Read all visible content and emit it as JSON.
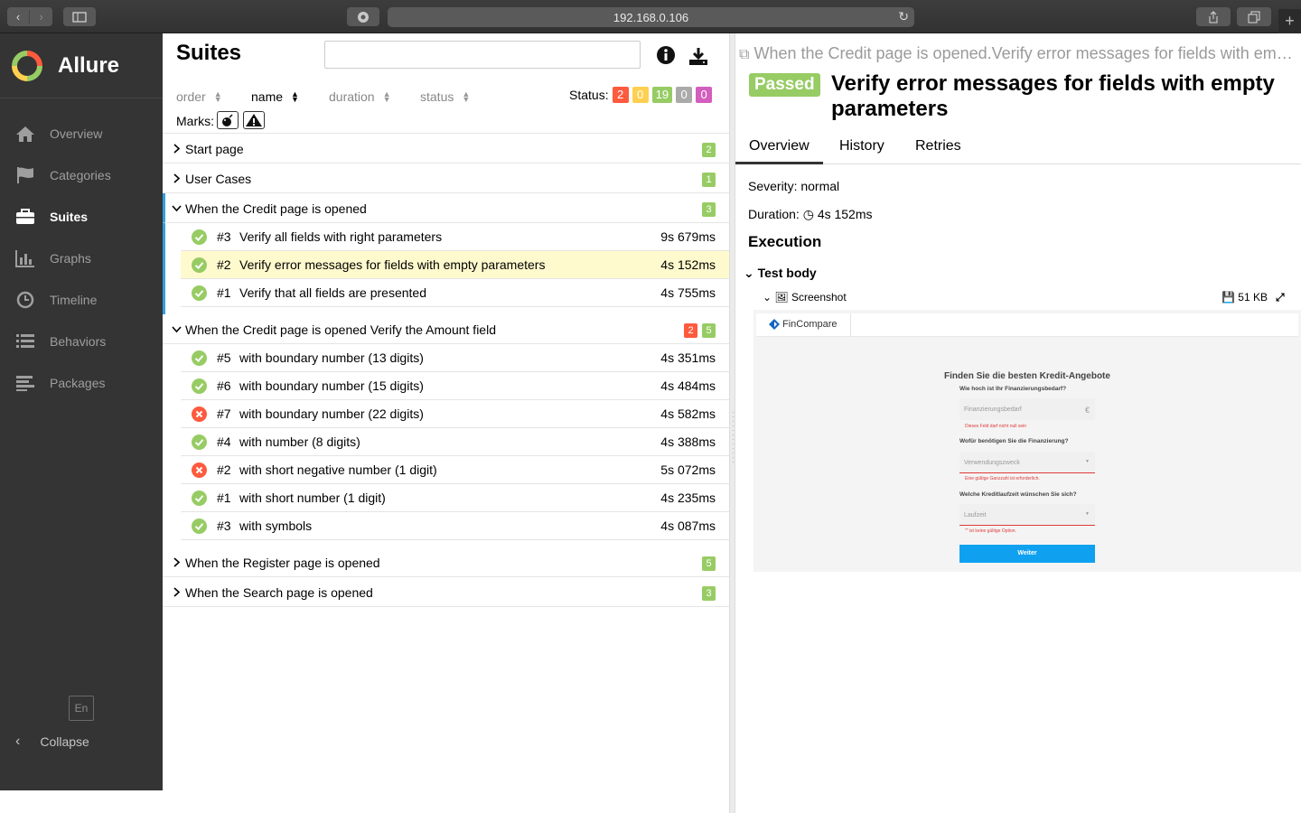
{
  "browser": {
    "url": "192.168.0.106"
  },
  "app": {
    "name": "Allure",
    "lang": "En",
    "collapse_label": "Collapse"
  },
  "nav": [
    {
      "label": "Overview",
      "icon": "home-icon"
    },
    {
      "label": "Categories",
      "icon": "flag-icon"
    },
    {
      "label": "Suites",
      "icon": "briefcase-icon",
      "active": true
    },
    {
      "label": "Graphs",
      "icon": "bar-chart-icon"
    },
    {
      "label": "Timeline",
      "icon": "clock-icon"
    },
    {
      "label": "Behaviors",
      "icon": "list-icon"
    },
    {
      "label": "Packages",
      "icon": "align-left-icon"
    }
  ],
  "suites": {
    "title": "Suites",
    "sort": [
      "order",
      "name",
      "duration",
      "status"
    ],
    "status_label": "Status:",
    "status_counts": [
      {
        "value": "2",
        "color": "#fd5a3e"
      },
      {
        "value": "0",
        "color": "#ffd050"
      },
      {
        "value": "19",
        "color": "#97cc64"
      },
      {
        "value": "0",
        "color": "#aaaaaa"
      },
      {
        "value": "0",
        "color": "#d35ebe"
      }
    ],
    "marks_label": "Marks:",
    "groups": [
      {
        "name": "Start page",
        "counts": [
          {
            "v": "2",
            "c": "#97cc64"
          }
        ],
        "expanded": false
      },
      {
        "name": "User Cases",
        "counts": [
          {
            "v": "1",
            "c": "#97cc64"
          }
        ],
        "expanded": false
      },
      {
        "name": "When the Credit page is opened",
        "counts": [
          {
            "v": "3",
            "c": "#97cc64"
          }
        ],
        "expanded": true,
        "cases": [
          {
            "num": "#3",
            "title": "Verify all fields with right parameters",
            "dur": "9s 679ms",
            "status": "passed"
          },
          {
            "num": "#2",
            "title": "Verify error messages for fields with empty parameters",
            "dur": "4s 152ms",
            "status": "passed",
            "selected": true
          },
          {
            "num": "#1",
            "title": "Verify that all fields are presented",
            "dur": "4s 755ms",
            "status": "passed"
          }
        ]
      },
      {
        "name": "When the Credit page is opened Verify the Amount field",
        "counts": [
          {
            "v": "2",
            "c": "#fd5a3e"
          },
          {
            "v": "5",
            "c": "#97cc64"
          }
        ],
        "expanded": true,
        "cases": [
          {
            "num": "#5",
            "title": "with boundary number (13 digits)",
            "dur": "4s 351ms",
            "status": "passed"
          },
          {
            "num": "#6",
            "title": "with boundary number (15 digits)",
            "dur": "4s 484ms",
            "status": "passed"
          },
          {
            "num": "#7",
            "title": "with boundary number (22 digits)",
            "dur": "4s 582ms",
            "status": "failed"
          },
          {
            "num": "#4",
            "title": "with number (8 digits)",
            "dur": "4s 388ms",
            "status": "passed"
          },
          {
            "num": "#2",
            "title": "with short negative number (1 digit)",
            "dur": "5s 072ms",
            "status": "failed"
          },
          {
            "num": "#1",
            "title": "with short number (1 digit)",
            "dur": "4s 235ms",
            "status": "passed"
          },
          {
            "num": "#3",
            "title": "with symbols",
            "dur": "4s 087ms",
            "status": "passed"
          }
        ]
      },
      {
        "name": "When the Register page is opened",
        "counts": [
          {
            "v": "5",
            "c": "#97cc64"
          }
        ],
        "expanded": false
      },
      {
        "name": "When the Search page is opened",
        "counts": [
          {
            "v": "3",
            "c": "#97cc64"
          }
        ],
        "expanded": false
      }
    ]
  },
  "detail": {
    "breadcrumb": "When the Credit page is opened.Verify error messages for fields with empty parameters",
    "status": "Passed",
    "title": "Verify error messages for fields with empty parameters",
    "tabs": [
      "Overview",
      "History",
      "Retries"
    ],
    "severity": "Severity: normal",
    "duration_label": "Duration:",
    "duration": "4s 152ms",
    "execution": "Execution",
    "test_body": "Test body",
    "attachment": {
      "name": "Screenshot",
      "size": "51 KB"
    },
    "screenshot": {
      "logo": "FinCompare",
      "heading": "Finden Sie die besten Kredit-Angebote",
      "q1": "Wie hoch ist Ihr Finanzierungsbedarf?",
      "in1": "Finanzierungsbedarf",
      "in1_suffix": "€",
      "err1": "Dieses Feld darf nicht null sein",
      "q2": "Wofür benötigen Sie die Finanzierung?",
      "in2": "Verwendungszweck",
      "err2": "Eine gültige Ganzzahl ist erforderlich.",
      "q3": "Welche Kreditlaufzeit wünschen Sie sich?",
      "in3": "Laufzeit",
      "err3": "\"\" ist keine gültige Option.",
      "button": "Weiter"
    }
  }
}
